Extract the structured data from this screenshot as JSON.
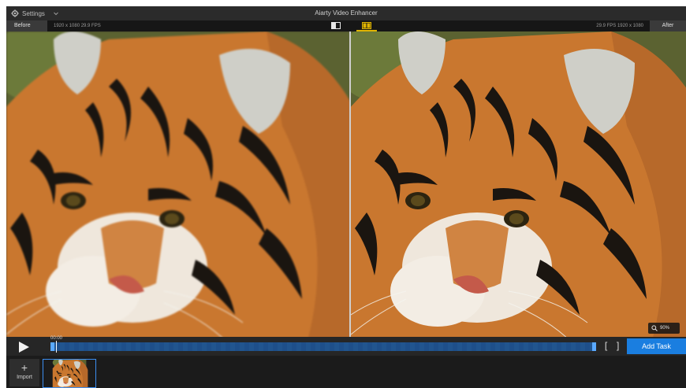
{
  "window": {
    "title": "Aiarty Video Enhancer",
    "settings_label": "Settings"
  },
  "compare": {
    "before_label": "Before",
    "before_info": "1920 x 1080  29.9 FPS",
    "after_label": "After",
    "after_info": "29.9 FPS  1920 x 1080"
  },
  "preview": {
    "zoom_level": "90%"
  },
  "timeline": {
    "timecode": "00:00",
    "add_task_label": "Add Task",
    "progress": 0.0
  },
  "filmstrip": {
    "import_label": "Import"
  },
  "colors": {
    "accent": "#1a7ee0",
    "track": "#1e4f8a",
    "mode_active": "#e0b400"
  }
}
